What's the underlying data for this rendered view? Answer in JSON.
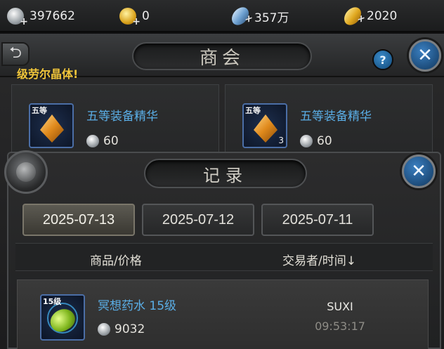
{
  "currencies": [
    {
      "icon": "silver-coin-icon",
      "value": "397662"
    },
    {
      "icon": "gold-coin-icon",
      "value": "0"
    },
    {
      "icon": "crystal-icon",
      "value": "357万"
    },
    {
      "icon": "gold-bar-icon",
      "value": "2020"
    }
  ],
  "shop": {
    "title": "商会",
    "marquee": "级劳尔晶体!",
    "back_icon": "back-arrow-icon",
    "help_label": "?",
    "close_label": "✕",
    "cards": [
      {
        "name": "五等装备精华",
        "grade": "五等",
        "count": "",
        "price": "60"
      },
      {
        "name": "五等装备精华",
        "grade": "五等",
        "count": "3",
        "price": "60"
      }
    ]
  },
  "record": {
    "title": "记录",
    "close_label": "✕",
    "tabs": [
      "2025-07-13",
      "2025-07-12",
      "2025-07-11"
    ],
    "active_tab": 0,
    "columns": {
      "item_price": "商品/价格",
      "trader_time": "交易者/时间↓"
    },
    "rows": [
      {
        "name": "冥想药水 15级",
        "grade": "15级",
        "price": "9032",
        "trader": "SUXI",
        "time": "09:53:17"
      }
    ]
  },
  "colors": {
    "accent_blue": "#5aaee6",
    "marquee_yellow": "#f0c53a"
  }
}
